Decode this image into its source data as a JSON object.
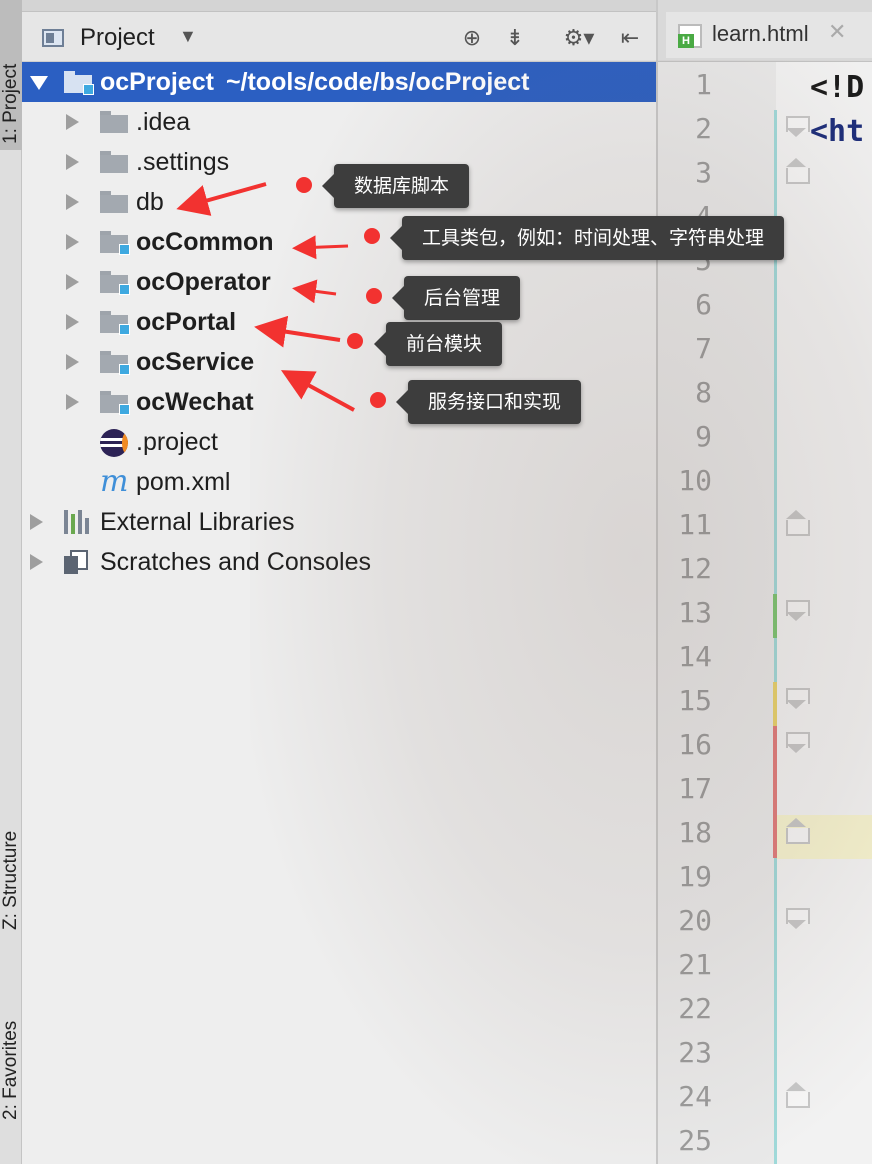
{
  "tool_windows": {
    "project": "1: Project",
    "structure": "Z: Structure",
    "favorites": "2: Favorites"
  },
  "panel": {
    "title": "Project",
    "icons": [
      "locate-icon",
      "collapse-all-icon",
      "gear-icon",
      "hide-panel-icon"
    ]
  },
  "tree": {
    "root": {
      "name": "ocProject",
      "path": "~/tools/code/bs/ocProject"
    },
    "items": [
      {
        "label": ".idea"
      },
      {
        "label": ".settings"
      },
      {
        "label": "db"
      },
      {
        "label": "ocCommon"
      },
      {
        "label": "ocOperator"
      },
      {
        "label": "ocPortal"
      },
      {
        "label": "ocService"
      },
      {
        "label": "ocWechat"
      },
      {
        "label": ".project"
      },
      {
        "label": "pom.xml"
      }
    ],
    "external_libraries": "External Libraries",
    "scratches": "Scratches and Consoles"
  },
  "annotations": [
    {
      "text": "数据库脚本",
      "target": "db"
    },
    {
      "text": "工具类包，例如：时间处理、字符串处理",
      "target": "ocCommon"
    },
    {
      "text": "后台管理",
      "target": "ocOperator"
    },
    {
      "text": "前台模块",
      "target": "ocPortal"
    },
    {
      "text": "服务接口和实现",
      "target": "ocService"
    }
  ],
  "annotation_color": "#f23230",
  "selection_color": "#2b5fc2",
  "editor": {
    "tab_label": "learn.html",
    "file_badge": "H",
    "code_lines": [
      "<!D",
      "<ht"
    ],
    "line_numbers": [
      "1",
      "2",
      "3",
      "4",
      "5",
      "6",
      "7",
      "8",
      "9",
      "10",
      "11",
      "12",
      "13",
      "14",
      "15",
      "16",
      "17",
      "18",
      "19",
      "20",
      "21",
      "22",
      "23",
      "24",
      "25"
    ],
    "current_line": "18"
  }
}
